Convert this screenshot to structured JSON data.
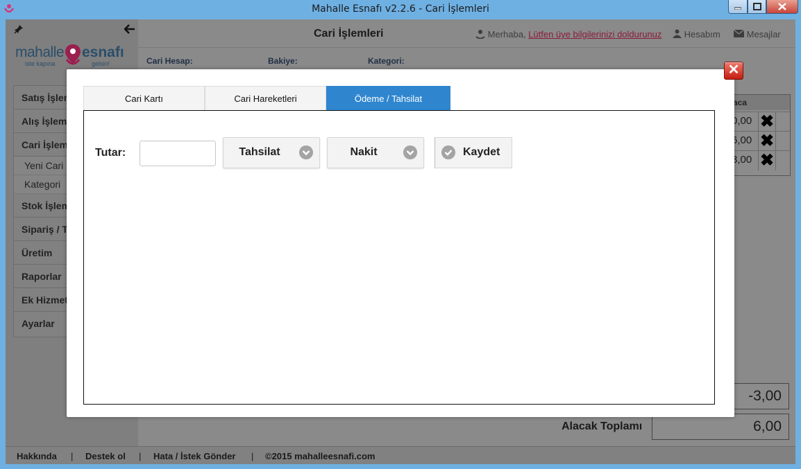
{
  "window": {
    "title": "Mahalle Esnafı v2.2.6 - Cari İşlemleri"
  },
  "logo": {
    "word1": "mahalle",
    "word2": "esnafı",
    "slogan1": "iste kapına",
    "slogan2": "gelsin!"
  },
  "sidebar": {
    "items": [
      {
        "label": "Satış İşlemleri"
      },
      {
        "label": "Alış İşlemleri"
      },
      {
        "label": "Cari İşlemleri"
      },
      {
        "label": "Stok İşlemleri"
      },
      {
        "label": "Sipariş / Teklif"
      },
      {
        "label": "Üretim"
      },
      {
        "label": "Raporlar"
      },
      {
        "label": "Ek Hizmetler"
      },
      {
        "label": "Ayarlar"
      }
    ],
    "subitems": [
      {
        "label": "Yeni Cari"
      },
      {
        "label": "Kategori"
      }
    ]
  },
  "header": {
    "page_title": "Cari İşlemleri",
    "greeting": "Merhaba,",
    "greeting_link": "Lütfen üye bilgilerinizi doldurunuz",
    "account": "Hesabım",
    "messages": "Mesajlar"
  },
  "filters": {
    "account_label": "Cari Hesap:",
    "balance_label": "Bakiye:",
    "category_label": "Kategori:"
  },
  "table": {
    "col_header": "aca",
    "rows": [
      {
        "value": "0,00"
      },
      {
        "value": "6,00"
      },
      {
        "value": "3,00"
      }
    ]
  },
  "totals": {
    "balance_value": "-3,00",
    "receivable_label": "Alacak Toplamı",
    "receivable_value": "6,00"
  },
  "footer": {
    "about": "Hakkında",
    "support": "Destek ol",
    "feedback": "Hata / İstek Gönder",
    "copyright": "©2015 mahalleesnafi.com",
    "sep": "|"
  },
  "modal": {
    "close_glyph": "✕",
    "tabs": [
      {
        "label": "Cari Kartı",
        "active": false
      },
      {
        "label": "Cari Hareketleri",
        "active": false
      },
      {
        "label": "Ödeme / Tahsilat",
        "active": true
      }
    ],
    "amount_label": "Tutar:",
    "amount_value": "",
    "type_select": "Tahsilat",
    "method_select": "Nakit",
    "save_label": "Kaydet"
  },
  "colors": {
    "active_tab": "#2f86cf",
    "titlebar": "#6fb0e3",
    "close_button": "#c41d10"
  }
}
